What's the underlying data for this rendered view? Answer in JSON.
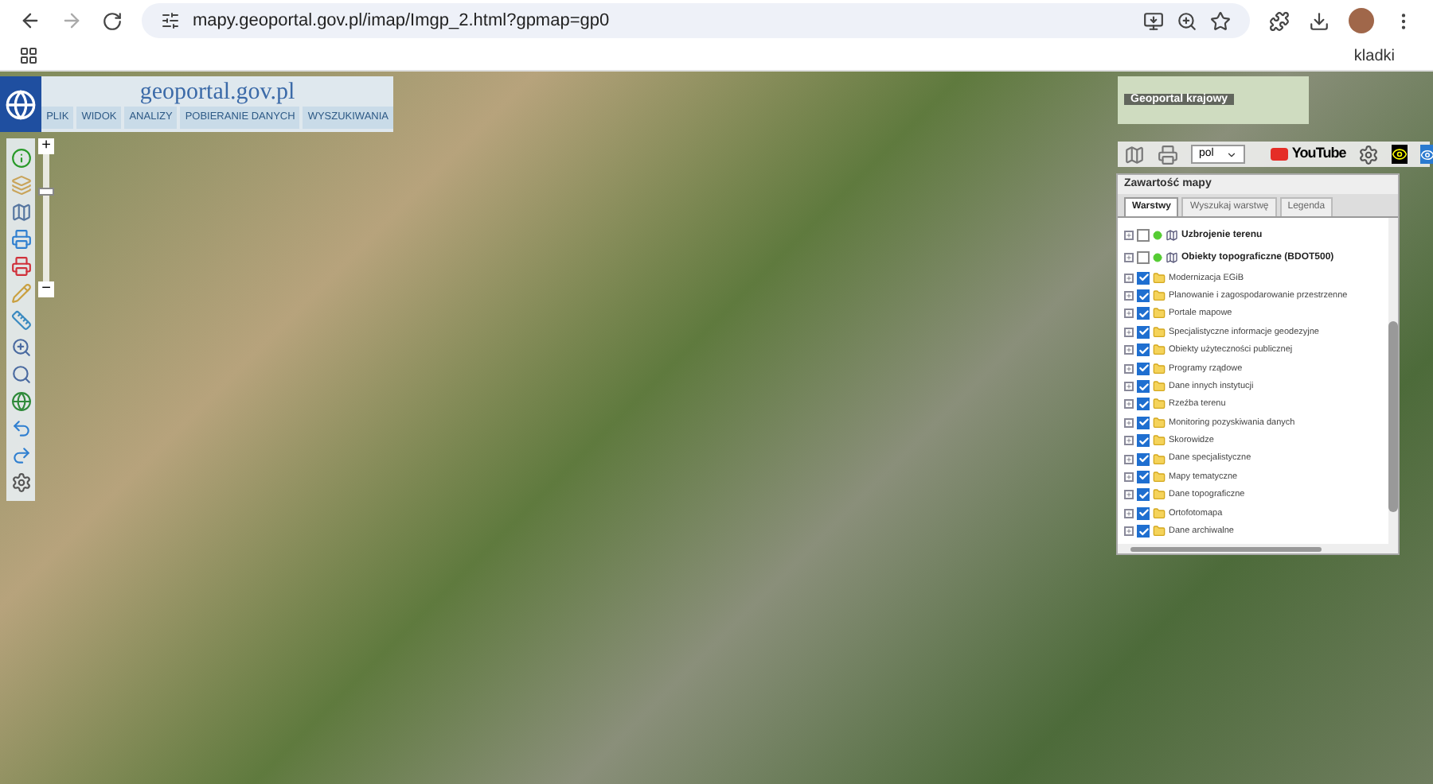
{
  "browser": {
    "url": "mapy.geoportal.gov.pl/imap/Imgp_2.html?gpmap=gp0",
    "bookmarks_label": "kladki"
  },
  "header": {
    "logo_text": "geoportal.gov.pl",
    "menu": [
      "PLIK",
      "WIDOK",
      "ANALIZY",
      "POBIERANIE DANYCH",
      "WYSZUKIWANIA"
    ]
  },
  "zoom": {
    "plus": "+",
    "minus": "−",
    "level": 0.72
  },
  "basemap": {
    "title": "Geoportal krajowy"
  },
  "toolbar": {
    "language": "pol",
    "youtube": "YouTube"
  },
  "panel": {
    "title": "Zawartość mapy",
    "tabs": [
      {
        "label": "Warstwy",
        "selected": true
      },
      {
        "label": "Wyszukaj warstwę",
        "selected": false
      },
      {
        "label": "Legenda",
        "selected": false
      }
    ],
    "layers": [
      {
        "label": "Uzbrojenie terenu",
        "kind": "service",
        "checked": false
      },
      {
        "label": "Obiekty topograficzne (BDOT500)",
        "kind": "service",
        "checked": false
      },
      {
        "label": "Modernizacja EGiB",
        "kind": "folder",
        "checked": true
      },
      {
        "label": "Planowanie i zagospodarowanie przestrzenne",
        "kind": "folder",
        "checked": true
      },
      {
        "label": "Portale mapowe",
        "kind": "folder",
        "checked": true
      },
      {
        "label": "Specjalistyczne informacje geodezyjne",
        "kind": "folder",
        "checked": true
      },
      {
        "label": "Obiekty użyteczności publicznej",
        "kind": "folder",
        "checked": true
      },
      {
        "label": "Programy rządowe",
        "kind": "folder",
        "checked": true
      },
      {
        "label": "Dane innych instytucji",
        "kind": "folder",
        "checked": true
      },
      {
        "label": "Rzeźba terenu",
        "kind": "folder",
        "checked": true
      },
      {
        "label": "Monitoring pozyskiwania danych",
        "kind": "folder",
        "checked": true
      },
      {
        "label": "Skorowidze",
        "kind": "folder",
        "checked": true
      },
      {
        "label": "Dane specjalistyczne",
        "kind": "folder",
        "checked": true
      },
      {
        "label": "Mapy tematyczne",
        "kind": "folder",
        "checked": true
      },
      {
        "label": "Dane topograficzne",
        "kind": "folder",
        "checked": true
      },
      {
        "label": "Ortofotomapa",
        "kind": "folder",
        "checked": true
      },
      {
        "label": "Dane archiwalne",
        "kind": "folder",
        "checked": true
      }
    ]
  }
}
